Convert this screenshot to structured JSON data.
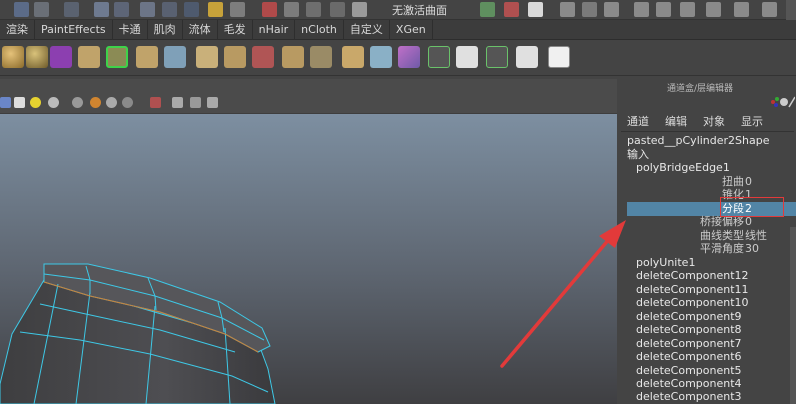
{
  "statusline": {
    "text": "无激活曲面"
  },
  "shelf": {
    "tabs": [
      "渲染",
      "PaintEffects",
      "卡通",
      "肌肉",
      "流体",
      "毛发",
      "nHair",
      "nCloth",
      "自定义",
      "XGen"
    ]
  },
  "channel_box": {
    "title": "通道盒/层编辑器",
    "menu": [
      "通道",
      "编辑",
      "对象",
      "显示"
    ],
    "object_name": "pasted__pCylinder2Shape",
    "inputs_label": "输入",
    "bridge_node": "polyBridgeEdge1",
    "attributes": [
      {
        "name": "扭曲",
        "value": "0"
      },
      {
        "name": "锥化",
        "value": "1"
      },
      {
        "name": "分段",
        "value": "2"
      },
      {
        "name": "桥接偏移",
        "value": "0"
      },
      {
        "name": "曲线类型",
        "value": "线性"
      },
      {
        "name": "平滑角度",
        "value": "30"
      }
    ],
    "history_nodes": [
      "polyUnite1",
      "deleteComponent12",
      "deleteComponent11",
      "deleteComponent10",
      "deleteComponent9",
      "deleteComponent8",
      "deleteComponent7",
      "deleteComponent6",
      "deleteComponent5",
      "deleteComponent4",
      "deleteComponent3"
    ]
  },
  "colors": {
    "highlight": "#5285a6",
    "annotation": "#e23a3a",
    "wireframe": "#3ec8e6",
    "viewport_top": "#7d8fa1",
    "viewport_bottom": "#3f3f42"
  }
}
